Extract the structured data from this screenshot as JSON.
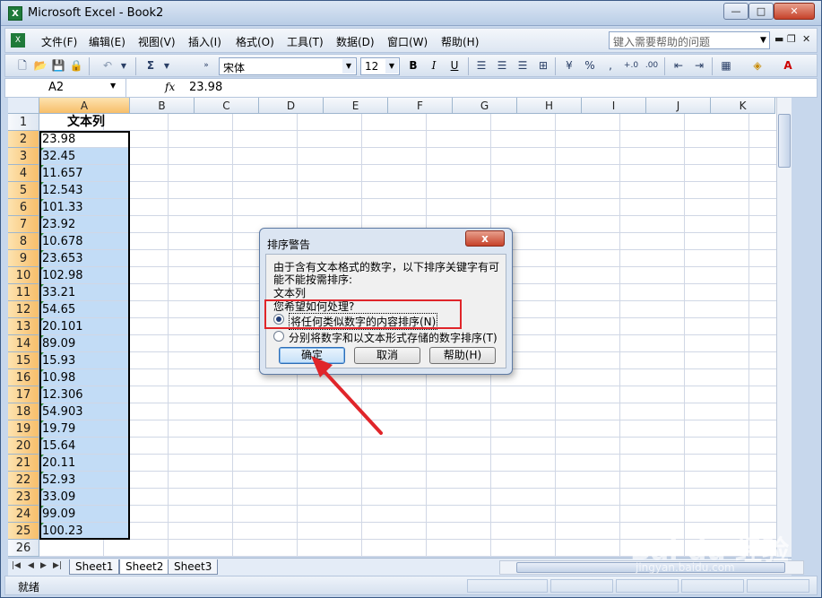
{
  "window": {
    "title": "Microsoft Excel - Book2",
    "icon": "excel-icon",
    "min": "—",
    "max": "□",
    "close": "✕"
  },
  "menu": {
    "items": [
      "文件(F)",
      "编辑(E)",
      "视图(V)",
      "插入(I)",
      "格式(O)",
      "工具(T)",
      "数据(D)",
      "窗口(W)",
      "帮助(H)"
    ],
    "help_placeholder": "键入需要帮助的问题"
  },
  "toolbar": {
    "font": "宋体",
    "size": "12",
    "bold": "B",
    "italic": "I",
    "underline": "U"
  },
  "formula": {
    "cell_ref": "A2",
    "fx": "fx",
    "value": "23.98"
  },
  "sheet": {
    "columns": [
      "A",
      "B",
      "C",
      "D",
      "E",
      "F",
      "G",
      "H",
      "I",
      "J",
      "K"
    ],
    "header_cell": "文本列",
    "values": [
      "23.98",
      "32.45",
      "11.657",
      "12.543",
      "101.33",
      "23.92",
      "10.678",
      "23.653",
      "102.98",
      "33.21",
      "54.65",
      "20.101",
      "89.09",
      "15.93",
      "10.98",
      "12.306",
      "54.903",
      "19.79",
      "15.64",
      "20.11",
      "52.93",
      "33.09",
      "99.09",
      "100.23"
    ],
    "rows": [
      "1",
      "2",
      "3",
      "4",
      "5",
      "6",
      "7",
      "8",
      "9",
      "10",
      "11",
      "12",
      "13",
      "14",
      "15",
      "16",
      "17",
      "18",
      "19",
      "20",
      "21",
      "22",
      "23",
      "24",
      "25",
      "26"
    ],
    "tabs": [
      "Sheet1",
      "Sheet2",
      "Sheet3"
    ]
  },
  "status": {
    "text": "就绪"
  },
  "dialog": {
    "title": "排序警告",
    "close": "x",
    "line1": "由于含有文本格式的数字，以下排序关键字有可",
    "line2": "能不能按需排序:",
    "key": "文本列",
    "question": "您希望如何处理?",
    "option1": "将任何类似数字的内容排序(N)",
    "option2": "分别将数字和以文本形式存储的数字排序(T)",
    "ok": "确定",
    "cancel": "取消",
    "help": "帮助(H)"
  },
  "watermark": {
    "brand": "Bai du 经验",
    "sub": "jingyan.baidu.com"
  },
  "colors": {
    "selection": "#c2dcf6",
    "selected_header": "#f7be6a",
    "annotation": "#e0252a"
  }
}
